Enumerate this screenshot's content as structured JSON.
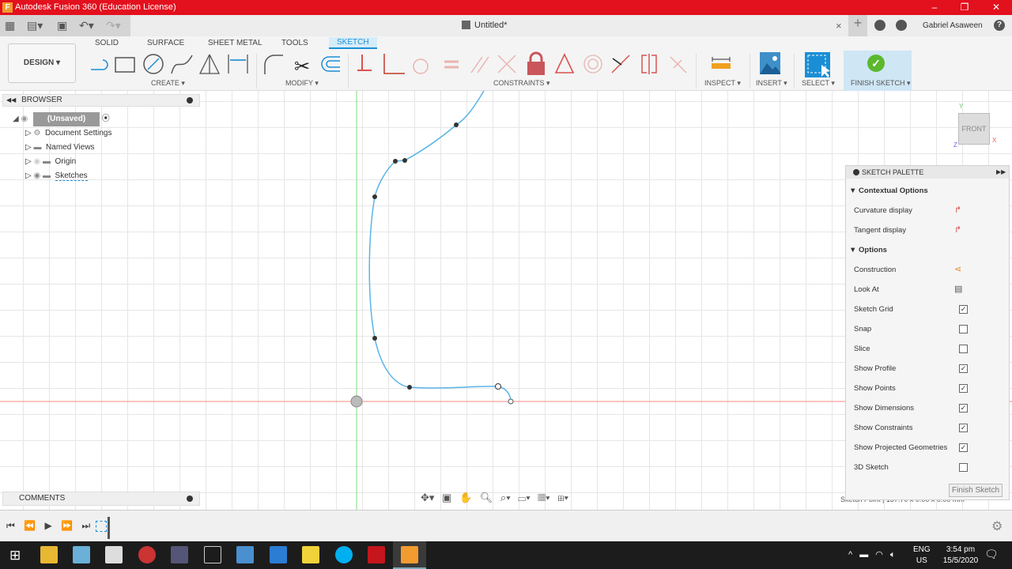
{
  "window": {
    "title": "Autodesk Fusion 360 (Education License)",
    "logo": "F",
    "minimize": "–",
    "restore": "❐",
    "close": "✕"
  },
  "quickbar": {
    "doc_title": "Untitled*",
    "close_tab": "×",
    "new_tab": "+",
    "user": "Gabriel Asaween",
    "help": "?"
  },
  "ribbon": {
    "workspace": "DESIGN ▾",
    "tabs": [
      {
        "label": "SOLID"
      },
      {
        "label": "SURFACE"
      },
      {
        "label": "SHEET METAL"
      },
      {
        "label": "TOOLS"
      },
      {
        "label": "SKETCH",
        "active": true
      }
    ],
    "groups": {
      "create": "CREATE ▾",
      "modify": "MODIFY ▾",
      "constraints": "CONSTRAINTS ▾",
      "inspect": "INSPECT ▾",
      "insert": "INSERT ▾",
      "select": "SELECT ▾",
      "finish": "FINISH SKETCH ▾"
    },
    "accent": "#1a8fd6",
    "constraint_color": "#d9534f"
  },
  "browser": {
    "title": "BROWSER",
    "items": [
      {
        "label": "(Unsaved)"
      },
      {
        "label": "Document Settings"
      },
      {
        "label": "Named Views"
      },
      {
        "label": "Origin"
      },
      {
        "label": "Sketches"
      }
    ]
  },
  "comments": {
    "title": "COMMENTS"
  },
  "viewcube": {
    "face": "FRONT",
    "x": "X",
    "y": "Y",
    "z": "Z"
  },
  "palette": {
    "title": "SKETCH PALETTE",
    "section1": "Contextual Options",
    "section2": "Options",
    "contextual": [
      {
        "label": "Curvature display"
      },
      {
        "label": "Tangent display"
      }
    ],
    "options": [
      {
        "label": "Construction",
        "type": "icon"
      },
      {
        "label": "Look At",
        "type": "icon"
      },
      {
        "label": "Sketch Grid",
        "checked": true
      },
      {
        "label": "Snap",
        "checked": false
      },
      {
        "label": "Slice",
        "checked": false
      },
      {
        "label": "Show Profile",
        "checked": true
      },
      {
        "label": "Show Points",
        "checked": true
      },
      {
        "label": "Show Dimensions",
        "checked": true
      },
      {
        "label": "Show Constraints",
        "checked": true
      },
      {
        "label": "Show Projected Geometries",
        "checked": true
      },
      {
        "label": "3D Sketch",
        "checked": false
      }
    ],
    "finish": "Finish Sketch"
  },
  "status": {
    "text": "Sketch Point | 137.70 x 0.00 x 0.00 mm"
  },
  "taskbar": {
    "lang1": "ENG",
    "lang2": "US",
    "time": "3:54 pm",
    "date": "15/5/2020"
  }
}
